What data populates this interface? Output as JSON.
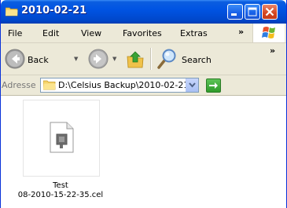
{
  "window": {
    "title": "2010-02-21",
    "buttons": [
      "minimize",
      "maximize",
      "close"
    ]
  },
  "menu": {
    "items": [
      "File",
      "Edit",
      "View",
      "Favorites",
      "Extras"
    ],
    "overflow": "»"
  },
  "toolbar": {
    "back_label": "Back",
    "search_label": "Search",
    "overflow": "»"
  },
  "address": {
    "label": "Adresse",
    "value": "D:\\Celsius Backup\\2010-02-21"
  },
  "files": [
    {
      "name_line1": "Test",
      "name_line2": "08-2010-15-22-35.cel",
      "icon": "generic-file-icon"
    }
  ],
  "colors": {
    "titlebar": "#0054e3",
    "chrome": "#ece9d8",
    "close_button": "#d5451f",
    "go_button": "#2f9b2a"
  }
}
